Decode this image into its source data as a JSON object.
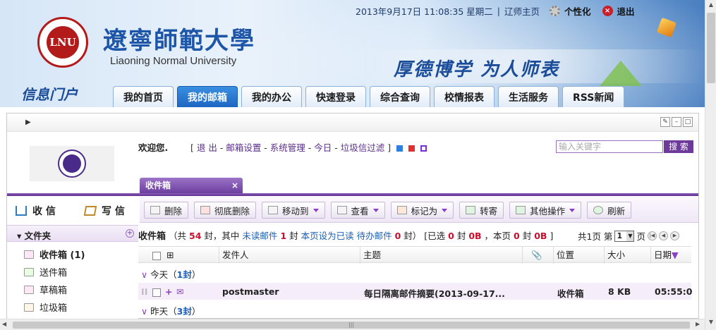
{
  "header": {
    "datetime": "2013年9月17日 11:08:35 星期二",
    "home_link": "辽师主页",
    "personalize": "个性化",
    "logout": "退出",
    "university_cn": "遼寧師範大學",
    "university_en": "Liaoning Normal University",
    "motto": "厚德博学 为人师表",
    "portal_title": "信息门户",
    "logo_text": "LNU"
  },
  "tabs": [
    {
      "label": "我的首页"
    },
    {
      "label": "我的邮箱"
    },
    {
      "label": "我的办公"
    },
    {
      "label": "快速登录"
    },
    {
      "label": "综合查询"
    },
    {
      "label": "校情报表"
    },
    {
      "label": "生活服务"
    },
    {
      "label": "RSS新闻"
    }
  ],
  "active_tab": 1,
  "mail": {
    "welcome": "欢迎您.",
    "links": [
      "退 出",
      "邮箱设置",
      "系统管理",
      "今日",
      "垃圾信过滤"
    ],
    "search_placeholder": "输入关键字",
    "search_button": "搜 索",
    "tab_title": "收件箱",
    "tab_close": "×",
    "theme_colors": [
      "#2f7fe0",
      "#e03030",
      "#7a2fd0"
    ]
  },
  "left": {
    "receive": "收 信",
    "write": "写 信",
    "folders_title": "文件夹",
    "folders": [
      {
        "label": "收件箱 (1)",
        "selected": true
      },
      {
        "label": "送件箱",
        "selected": false
      },
      {
        "label": "草稿箱",
        "selected": false
      },
      {
        "label": "垃圾箱",
        "selected": false
      }
    ]
  },
  "toolbar": {
    "delete": "删除",
    "purge": "彻底删除",
    "move_to": "移动到",
    "view": "查看",
    "mark_as": "标记为",
    "forward": "转寄",
    "other": "其他操作",
    "refresh": "刷新"
  },
  "status": {
    "folder": "收件箱",
    "text1": "（共",
    "total": "54",
    "text2": "封，其中",
    "unread_label": "未读邮件",
    "unread": "1",
    "text3": "封",
    "mark_read": "本页设为已读",
    "pending_label": "待办邮件",
    "pending": "0",
    "text4": "封）",
    "text5": "[已选",
    "selected": "0",
    "text6": "封",
    "selected_size": "0B",
    "text7": "，本页",
    "page_count": "0",
    "text8": "封",
    "page_size": "0B",
    "text9": "]"
  },
  "pager": {
    "total": "共1页 第",
    "current": "1",
    "suffix": "页"
  },
  "table": {
    "columns": {
      "sender": "发件人",
      "subject": "主题",
      "location": "位置",
      "size": "大小",
      "date": "日期"
    },
    "today_label": "今天（",
    "today_count": "1封",
    "group_close": "）",
    "yesterday_label": "昨天（",
    "yesterday_count": "3封",
    "rows": [
      {
        "sender": "postmaster",
        "subject": "每日隔离邮件摘要(2013-09-17...",
        "location": "收件箱",
        "size": "8 KB",
        "date": "05:55:0"
      }
    ]
  },
  "hscroll_grip": "|||"
}
